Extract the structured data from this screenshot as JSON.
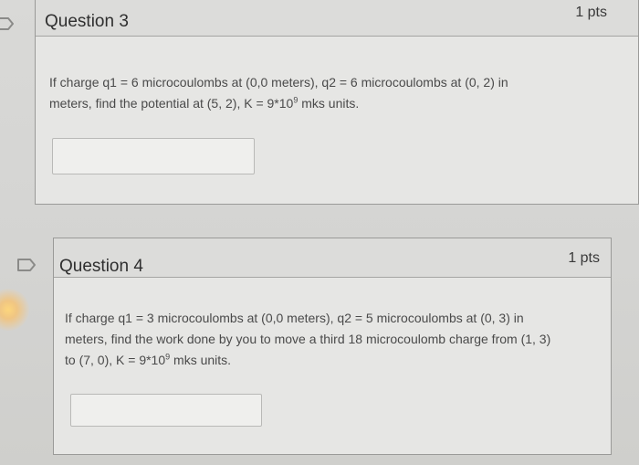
{
  "questions": [
    {
      "title": "Question 3",
      "points": "1 pts",
      "text_line1": "If charge q1 = 6 microcoulombs at (0,0 meters), q2 = 6 microcoulombs at (0, 2) in",
      "text_line2": "meters, find the potential at (5, 2), K = 9*10",
      "exponent": "9",
      "text_tail": " mks units.",
      "answer_value": ""
    },
    {
      "title": "Question 4",
      "points": "1 pts",
      "text_line1": "If charge q1 = 3 microcoulombs at (0,0 meters), q2 = 5 microcoulombs at (0, 3) in",
      "text_line2": "meters, find the work done by you to move a third 18 microcoulomb charge from (1, 3)",
      "text_line3": "to (7, 0), K = 9*10",
      "exponent": "9",
      "text_tail": " mks units.",
      "answer_value": ""
    }
  ],
  "icons": {
    "flag": "flag-icon"
  },
  "colors": {
    "background": "#d6d6d4",
    "card": "#e6e6e4",
    "header": "#dcdcda",
    "border": "#9a9a98"
  }
}
